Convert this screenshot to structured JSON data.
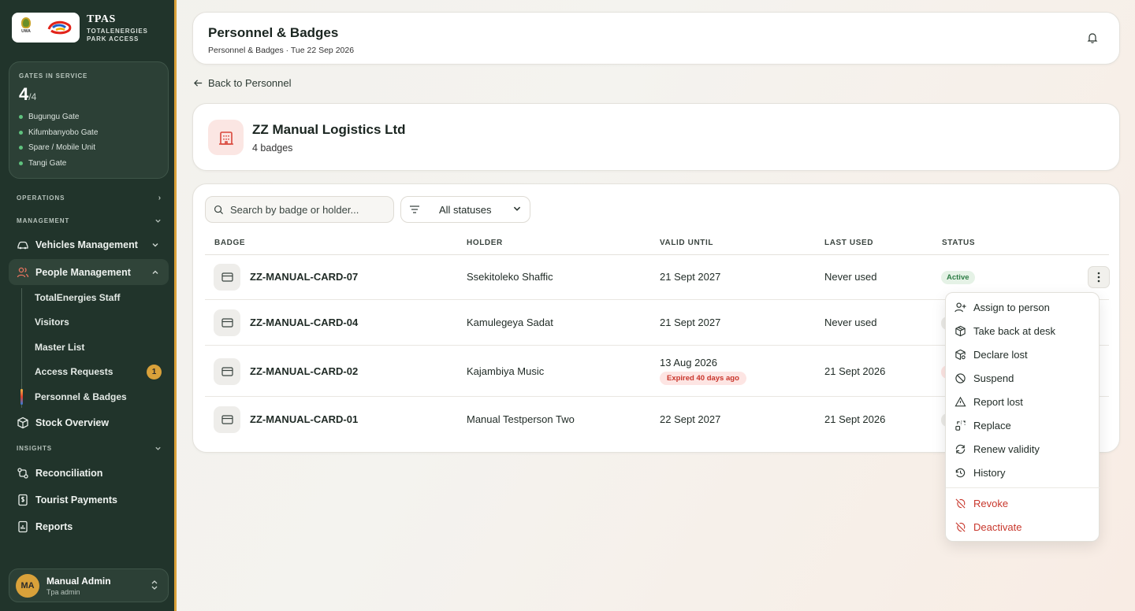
{
  "brand": {
    "title": "TPAS",
    "subtitle_line1": "TOTALENERGIES",
    "subtitle_line2": "PARK ACCESS",
    "uwa_mark": "UWA"
  },
  "gates": {
    "label": "GATES IN SERVICE",
    "count": "4",
    "total": "/4",
    "items": [
      "Bugungu Gate",
      "Kifumbanyobo Gate",
      "Spare / Mobile Unit",
      "Tangi Gate"
    ],
    "status_color": "#5fc27e"
  },
  "nav": {
    "section_operations": "OPERATIONS",
    "section_management": "MANAGEMENT",
    "vehicles": "Vehicles Management",
    "people": "People Management",
    "people_sub": [
      "TotalEnergies Staff",
      "Visitors",
      "Master List",
      "Access Requests",
      "Personnel & Badges"
    ],
    "access_requests_count": "1",
    "stock": "Stock Overview",
    "section_insights": "INSIGHTS",
    "reconciliation": "Reconciliation",
    "tourist_payments": "Tourist Payments",
    "reports": "Reports"
  },
  "user": {
    "initials": "MA",
    "name": "Manual Admin",
    "role": "Tpa admin"
  },
  "header": {
    "title": "Personnel & Badges",
    "subtitle": "Personnel & Badges · Tue 22 Sep 2026"
  },
  "back_link": "Back to Personnel",
  "org": {
    "name": "ZZ Manual Logistics Ltd",
    "badge_count": "4 badges"
  },
  "filters": {
    "search_placeholder": "Search by badge or holder...",
    "status_value": "All statuses"
  },
  "table": {
    "columns": [
      "BADGE",
      "HOLDER",
      "VALID UNTIL",
      "LAST USED",
      "STATUS"
    ],
    "rows": [
      {
        "badge": "ZZ-MANUAL-CARD-07",
        "holder": "Ssekitoleko Shaffic",
        "valid_until": "21 Sept 2027",
        "last_used": "Never used",
        "status": "Active"
      },
      {
        "badge": "ZZ-MANUAL-CARD-04",
        "holder": "Kamulegeya Sadat",
        "valid_until": "21 Sept 2027",
        "last_used": "Never used",
        "status": ""
      },
      {
        "badge": "ZZ-MANUAL-CARD-02",
        "holder": "Kajambiya Music",
        "valid_until": "13 Aug 2026",
        "valid_note": "Expired 40 days ago",
        "last_used": "21 Sept 2026",
        "status": ""
      },
      {
        "badge": "ZZ-MANUAL-CARD-01",
        "holder": "Manual Testperson Two",
        "valid_until": "22 Sept 2027",
        "last_used": "21 Sept 2026",
        "status": ""
      }
    ]
  },
  "menu": {
    "items": [
      "Assign to person",
      "Take back at desk",
      "Declare lost",
      "Suspend",
      "Report lost",
      "Replace",
      "Renew validity",
      "History"
    ],
    "danger_items": [
      "Revoke",
      "Deactivate"
    ]
  },
  "colors": {
    "sidebar_bg": "#21342b",
    "accent": "#d9a13a",
    "active_green": "#2e7d46",
    "danger_red": "#c8372c"
  }
}
